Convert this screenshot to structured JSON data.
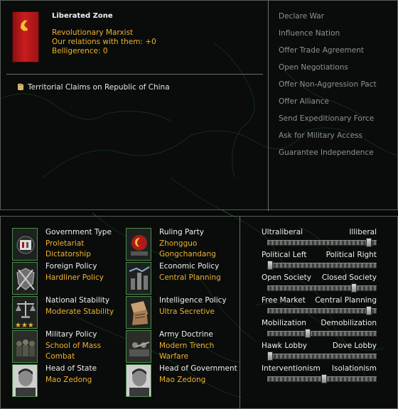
{
  "country": {
    "name": "Liberated Zone",
    "ideology": "Revolutionary Marxist",
    "relations": "Our relations with them: +0",
    "belligerence": "Belligerence: 0",
    "flag_color": "#c81d20"
  },
  "claims": {
    "icon": "raised-fist-icon",
    "text": "Territorial Claims on Republic of China"
  },
  "actions": [
    "Declare War",
    "Influence Nation",
    "Offer Trade Agreement",
    "Open Negotiations",
    "Offer Non-Aggression Pact",
    "Offer Alliance",
    "Send Expeditionary Force",
    "Ask for Military Access",
    "Guarantee Independence"
  ],
  "policies_left": [
    {
      "label": "Government Type",
      "value_1": "Proletariat",
      "value_2": "Dictatorship",
      "icon": "government-type-icon"
    },
    {
      "label": "Foreign Policy",
      "value_1": "Hardliner Policy",
      "value_2": "",
      "icon": "foreign-policy-icon"
    },
    {
      "label": "National Stability",
      "value_1": "Moderate Stability",
      "value_2": "",
      "icon": "stability-scales-icon",
      "stars": 3
    },
    {
      "label": "Military Policy",
      "value_1": "School of Mass",
      "value_2": "Combat",
      "icon": "military-policy-icon"
    },
    {
      "label": "Head of State",
      "value_1": "Mao Zedong",
      "value_2": "",
      "icon": "head-of-state-portrait"
    }
  ],
  "policies_right": [
    {
      "label": "Ruling Party",
      "value_1": "Zhongguo",
      "value_2": "Gongchandang",
      "icon": "ruling-party-icon"
    },
    {
      "label": "Economic Policy",
      "value_1": "Central Planning",
      "value_2": "",
      "icon": "economic-policy-icon"
    },
    {
      "label": "Intelligence Policy",
      "value_1": "Ultra Secretive",
      "value_2": "",
      "icon": "intelligence-policy-icon"
    },
    {
      "label": "Army Doctrine",
      "value_1": "Modern Trench",
      "value_2": "Warfare",
      "icon": "army-doctrine-icon"
    },
    {
      "label": "Head of Government",
      "value_1": "Mao Zedong",
      "value_2": "",
      "icon": "head-of-government-portrait"
    }
  ],
  "sliders": [
    {
      "left": "Ultraliberal",
      "right": "Illiberal",
      "position": 0.95
    },
    {
      "left": "Political Left",
      "right": "Political Right",
      "position": 0.0
    },
    {
      "left": "Open Society",
      "right": "Closed Society",
      "position": 0.81
    },
    {
      "left": "Free Market",
      "right": "Central Planning",
      "position": 0.95
    },
    {
      "left": "Mobilization",
      "right": "Demobilization",
      "position": 0.36
    },
    {
      "left": "Hawk Lobby",
      "right": "Dove Lobby",
      "position": 0.0
    },
    {
      "left": "Interventionism",
      "right": "Isolationism",
      "position": 0.52
    }
  ],
  "colors": {
    "accent_value": "#f0b030",
    "disabled_action": "#8f948f",
    "map_lines": "#1f6a2a"
  }
}
